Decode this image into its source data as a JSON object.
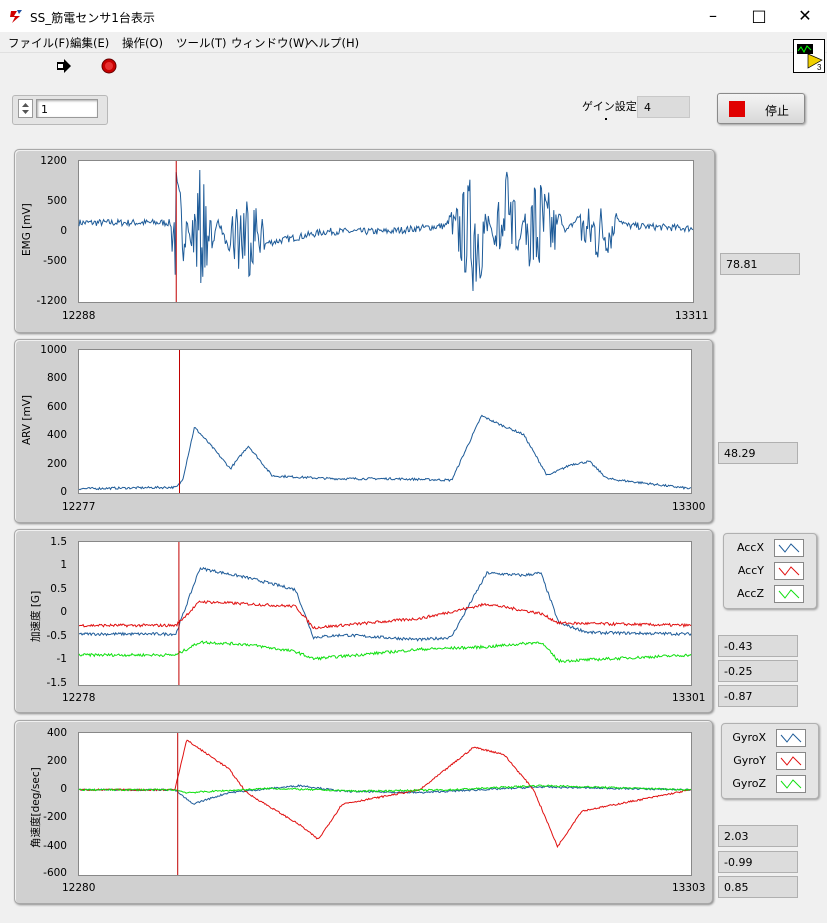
{
  "window": {
    "title": "SS_筋電センサ1台表示"
  },
  "menu": [
    "ファイル(F)",
    "編集(E)",
    "操作(O)",
    "ツール(T)",
    "ウィンドウ(W)",
    "ヘルプ(H)"
  ],
  "toolbar": {
    "run_icon": "run-arrow-icon",
    "abort_icon": "abort-stop-icon"
  },
  "controls": {
    "channel_value": "1",
    "gain_label": "ゲイン設定",
    "gain_value": "4",
    "stop_label": "停止"
  },
  "colors": {
    "blue": "#1f5c99",
    "red": "#e01010",
    "green": "#10e010",
    "cursor": "#c00000"
  },
  "charts": [
    {
      "id": "emg",
      "ylabel": "EMG [mV]",
      "yticks": [
        "1200",
        "500",
        "0",
        "-500",
        "-1200"
      ],
      "xmin": "12288",
      "xmax": "13311",
      "values": [
        "78.81"
      ]
    },
    {
      "id": "arv",
      "ylabel": "ARV [mV]",
      "yticks": [
        "1000",
        "800",
        "600",
        "400",
        "200",
        "0"
      ],
      "xmin": "12277",
      "xmax": "13300",
      "values": [
        "48.29"
      ]
    },
    {
      "id": "acc",
      "ylabel": "加速度 [G]",
      "yticks": [
        "1.5",
        "1",
        "0.5",
        "0",
        "-0.5",
        "-1",
        "-1.5"
      ],
      "xmin": "12278",
      "xmax": "13301",
      "legend": [
        "AccX",
        "AccY",
        "AccZ"
      ],
      "values": [
        "-0.43",
        "-0.25",
        "-0.87"
      ]
    },
    {
      "id": "gyro",
      "ylabel": "角速度[deg/sec]",
      "yticks": [
        "400",
        "200",
        "0",
        "-200",
        "-400",
        "-600"
      ],
      "xmin": "12280",
      "xmax": "13303",
      "legend": [
        "GyroX",
        "GyroY",
        "GyroZ"
      ],
      "values": [
        "2.03",
        "-0.99",
        "0.85"
      ]
    }
  ],
  "chart_data": [
    {
      "type": "line",
      "ylabel": "EMG [mV]",
      "x_range": [
        12288,
        13311
      ],
      "ylim": [
        -1200,
        1200
      ],
      "series": [
        {
          "color": "#1f5c99",
          "envelope": [
            [
              12288,
              150
            ],
            [
              12440,
              150
            ],
            [
              12450,
              1200
            ],
            [
              12490,
              -1100
            ],
            [
              12520,
              200
            ],
            [
              12560,
              -1000
            ],
            [
              12600,
              -200
            ],
            [
              12700,
              0
            ],
            [
              12800,
              0
            ],
            [
              12900,
              100
            ],
            [
              12950,
              1200
            ],
            [
              13000,
              -1200
            ],
            [
              13050,
              1200
            ],
            [
              13100,
              0
            ],
            [
              13150,
              600
            ],
            [
              13200,
              100
            ],
            [
              13311,
              50
            ]
          ]
        }
      ]
    },
    {
      "type": "line",
      "ylabel": "ARV [mV]",
      "x_range": [
        12277,
        13300
      ],
      "ylim": [
        0,
        1000
      ],
      "series": [
        {
          "color": "#1f5c99",
          "points": [
            [
              12277,
              30
            ],
            [
              12440,
              40
            ],
            [
              12450,
              90
            ],
            [
              12470,
              460
            ],
            [
              12500,
              320
            ],
            [
              12530,
              170
            ],
            [
              12560,
              330
            ],
            [
              12600,
              120
            ],
            [
              12700,
              100
            ],
            [
              12800,
              100
            ],
            [
              12900,
              90
            ],
            [
              12950,
              540
            ],
            [
              12980,
              480
            ],
            [
              13020,
              410
            ],
            [
              13060,
              120
            ],
            [
              13100,
              200
            ],
            [
              13130,
              220
            ],
            [
              13160,
              100
            ],
            [
              13300,
              30
            ]
          ]
        }
      ]
    },
    {
      "type": "line",
      "ylabel": "加速度 [G]",
      "x_range": [
        12278,
        13301
      ],
      "ylim": [
        -1.5,
        1.5
      ],
      "series": [
        {
          "name": "AccX",
          "color": "#1f5c99",
          "points": [
            [
              12278,
              -0.43
            ],
            [
              12440,
              -0.43
            ],
            [
              12480,
              0.95
            ],
            [
              12560,
              0.75
            ],
            [
              12640,
              0.5
            ],
            [
              12670,
              -0.5
            ],
            [
              12720,
              -0.45
            ],
            [
              12850,
              -0.55
            ],
            [
              12900,
              -0.5
            ],
            [
              12960,
              0.85
            ],
            [
              13020,
              0.8
            ],
            [
              13050,
              0.85
            ],
            [
              13080,
              -0.2
            ],
            [
              13130,
              -0.4
            ],
            [
              13301,
              -0.43
            ]
          ]
        },
        {
          "name": "AccY",
          "color": "#e01010",
          "points": [
            [
              12278,
              -0.25
            ],
            [
              12440,
              -0.25
            ],
            [
              12480,
              0.25
            ],
            [
              12560,
              0.2
            ],
            [
              12640,
              0.15
            ],
            [
              12670,
              -0.3
            ],
            [
              12850,
              -0.1
            ],
            [
              12960,
              0.2
            ],
            [
              13050,
              0.0
            ],
            [
              13080,
              -0.2
            ],
            [
              13301,
              -0.25
            ]
          ]
        },
        {
          "name": "AccZ",
          "color": "#10e010",
          "points": [
            [
              12278,
              -0.87
            ],
            [
              12440,
              -0.87
            ],
            [
              12480,
              -0.6
            ],
            [
              12560,
              -0.65
            ],
            [
              12640,
              -0.8
            ],
            [
              12670,
              -0.95
            ],
            [
              12850,
              -0.75
            ],
            [
              12960,
              -0.7
            ],
            [
              13050,
              -0.6
            ],
            [
              13080,
              -1.0
            ],
            [
              13301,
              -0.87
            ]
          ]
        }
      ]
    },
    {
      "type": "line",
      "ylabel": "角速度[deg/sec]",
      "x_range": [
        12280,
        13303
      ],
      "ylim": [
        -600,
        400
      ],
      "series": [
        {
          "name": "GyroX",
          "color": "#1f5c99",
          "points": [
            [
              12280,
              0
            ],
            [
              12440,
              0
            ],
            [
              12470,
              -100
            ],
            [
              12530,
              -20
            ],
            [
              12650,
              30
            ],
            [
              12720,
              -10
            ],
            [
              12850,
              -20
            ],
            [
              12950,
              0
            ],
            [
              13050,
              20
            ],
            [
              13303,
              0
            ]
          ]
        },
        {
          "name": "GyroY",
          "color": "#e01010",
          "points": [
            [
              12280,
              0
            ],
            [
              12440,
              0
            ],
            [
              12460,
              350
            ],
            [
              12530,
              150
            ],
            [
              12560,
              -20
            ],
            [
              12650,
              -250
            ],
            [
              12680,
              -350
            ],
            [
              12720,
              -100
            ],
            [
              12850,
              0
            ],
            [
              12940,
              300
            ],
            [
              12990,
              250
            ],
            [
              13040,
              0
            ],
            [
              13080,
              -400
            ],
            [
              13120,
              -150
            ],
            [
              13303,
              0
            ]
          ]
        },
        {
          "name": "GyroZ",
          "color": "#10e010",
          "points": [
            [
              12280,
              0
            ],
            [
              12440,
              0
            ],
            [
              12460,
              -20
            ],
            [
              12600,
              10
            ],
            [
              12750,
              -10
            ],
            [
              12900,
              0
            ],
            [
              13050,
              30
            ],
            [
              13303,
              0
            ]
          ]
        }
      ]
    }
  ]
}
